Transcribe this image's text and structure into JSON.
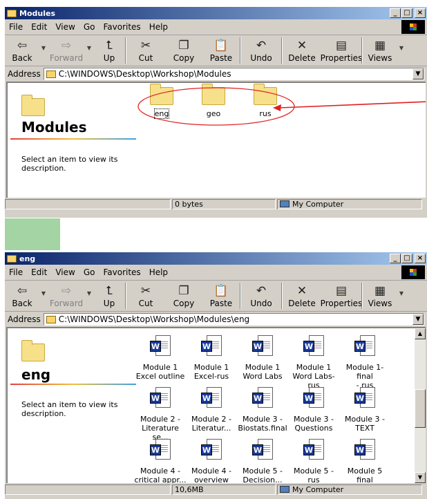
{
  "top_window": {
    "title": "Modules",
    "menu": [
      "File",
      "Edit",
      "View",
      "Go",
      "Favorites",
      "Help"
    ],
    "toolbar": [
      "Back",
      "Forward",
      "Up",
      "Cut",
      "Copy",
      "Paste",
      "Undo",
      "Delete",
      "Properties",
      "Views"
    ],
    "address_label": "Address",
    "address": "C:\\WINDOWS\\Desktop\\Workshop\\Modules",
    "left_title": "Modules",
    "left_desc": "Select an item to view its description.",
    "items": [
      "eng",
      "geo",
      "rus"
    ],
    "status_size": "0 bytes",
    "status_zone": "My Computer"
  },
  "bottom_window": {
    "title": "eng",
    "menu": [
      "File",
      "Edit",
      "View",
      "Go",
      "Favorites",
      "Help"
    ],
    "toolbar": [
      "Back",
      "Forward",
      "Up",
      "Cut",
      "Copy",
      "Paste",
      "Undo",
      "Delete",
      "Properties",
      "Views"
    ],
    "address_label": "Address",
    "address": "C:\\WINDOWS\\Desktop\\Workshop\\Modules\\eng",
    "left_title": "eng",
    "left_desc": "Select an item to view its description.",
    "files": [
      {
        "l1": "Module 1",
        "l2": "Excel outline"
      },
      {
        "l1": "Module 1",
        "l2": "Excel-rus"
      },
      {
        "l1": "Module 1",
        "l2": "Word Labs"
      },
      {
        "l1": "Module 1",
        "l2": "Word Labs-rus"
      },
      {
        "l1": "Module 1-final",
        "l2": "- rus"
      },
      {
        "l1": "Module 2 -",
        "l2": "Literature se..."
      },
      {
        "l1": "Module 2 -",
        "l2": "Literatur..."
      },
      {
        "l1": "Module 3 -",
        "l2": "Biostats.final"
      },
      {
        "l1": "Module 3 -",
        "l2": "Questions"
      },
      {
        "l1": "Module 3 -",
        "l2": "TEXT"
      },
      {
        "l1": "Module 4 -",
        "l2": "critical appr..."
      },
      {
        "l1": "Module 4 -",
        "l2": "overview"
      },
      {
        "l1": "Module 5 -",
        "l2": "Decision..."
      },
      {
        "l1": "Module 5 - rus",
        "l2": ""
      },
      {
        "l1": "Module 5 final",
        "l2": ""
      }
    ],
    "status_size": "10,6MB",
    "status_zone": "My Computer"
  },
  "annotation": {
    "color": "#e02020"
  },
  "colors": {
    "title_start": "#0a246a",
    "title_end": "#a6caf0",
    "chrome": "#d4d0c8",
    "folder": "#f7e08a"
  }
}
